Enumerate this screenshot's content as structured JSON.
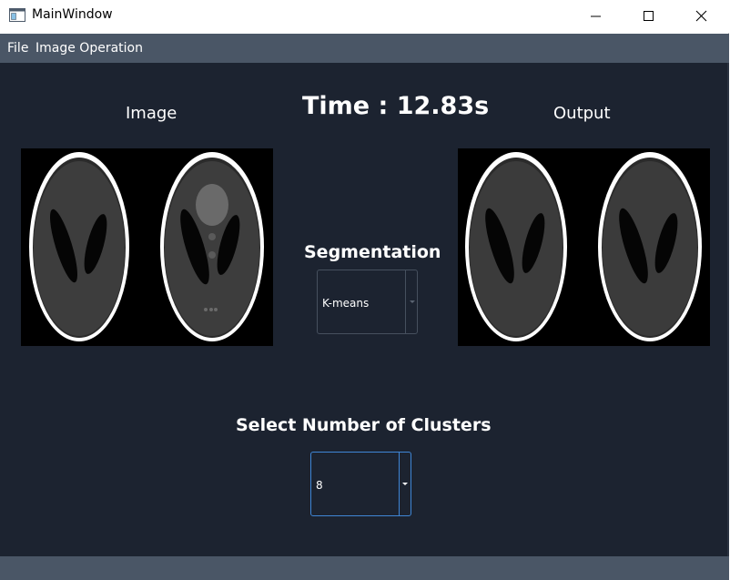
{
  "window": {
    "title": "MainWindow"
  },
  "menu": {
    "items": [
      "File",
      "Image Operation"
    ]
  },
  "main": {
    "image_label": "Image",
    "output_label": "Output",
    "time_label": "Time : 12.83s",
    "segmentation_label": "Segmentation",
    "segmentation_value": "K-means",
    "clusters_label": "Select Number of Clusters",
    "clusters_value": "8"
  },
  "colors": {
    "content_bg": "#1c2330",
    "menubar_bg": "#4a5666",
    "focus_border": "#3f86d6"
  },
  "icons": {
    "app": "window-icon",
    "minimize": "minimize-icon",
    "maximize": "maximize-icon",
    "close": "close-icon",
    "dropdown": "chevron-down-icon"
  }
}
